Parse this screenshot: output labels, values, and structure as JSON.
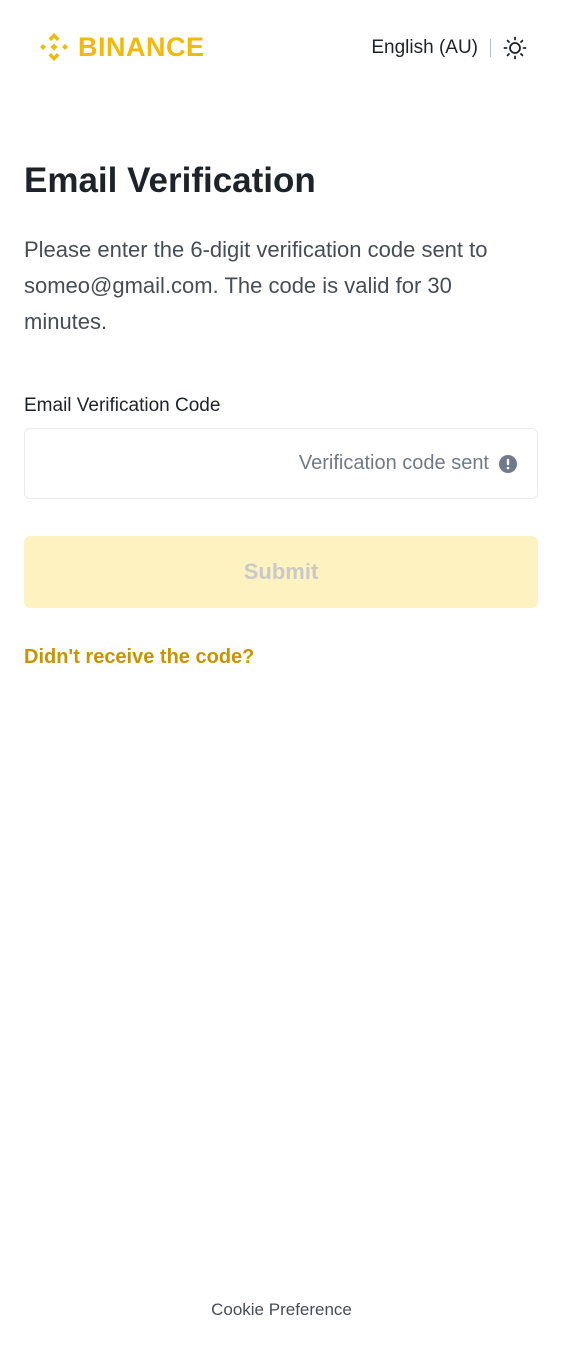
{
  "brand": {
    "name": "BINANCE",
    "logo_icon": "binance-diamond-icon",
    "color": "#F0B90B"
  },
  "header": {
    "language": "English (AU)",
    "theme_icon": "sun-icon"
  },
  "main": {
    "title": "Email Verification",
    "description": "Please enter the 6-digit verification code sent to someo@gmail.com. The code is valid for 30 minutes.",
    "code_field": {
      "label": "Email Verification Code",
      "value": "",
      "status_text": "Verification code sent",
      "status_icon": "exclamation-circle-icon"
    },
    "submit_label": "Submit",
    "submit_disabled": true,
    "resend_link": "Didn't receive the code?"
  },
  "footer": {
    "cookie_link": "Cookie Preference"
  },
  "colors": {
    "accent": "#F0B90B",
    "link": "#C99400",
    "button_disabled_bg": "#FEF2C0",
    "button_disabled_text": "#C9C9C9",
    "text_primary": "#1E2329",
    "text_secondary": "#474D57"
  }
}
